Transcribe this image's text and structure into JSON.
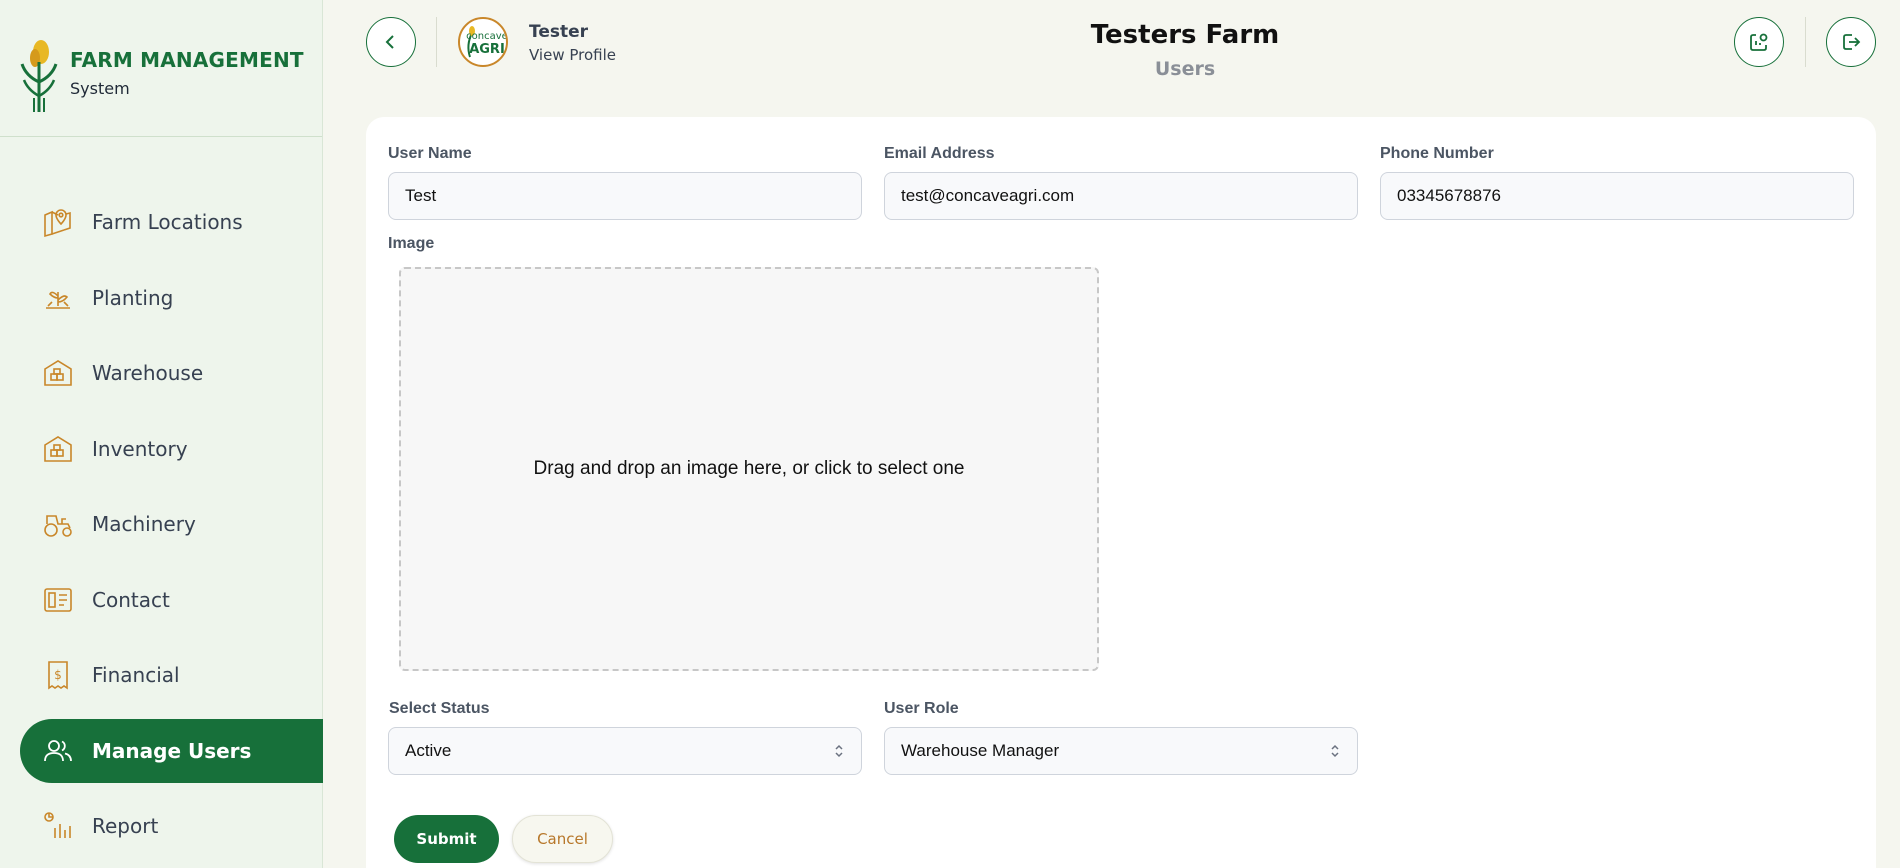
{
  "brand": {
    "title": "FARM MANAGEMENT",
    "subtitle": "System"
  },
  "sidebar": {
    "items": [
      {
        "label": "Farm Locations",
        "icon": "map-pin-icon",
        "active": false
      },
      {
        "label": "Planting",
        "icon": "plant-icon",
        "active": false
      },
      {
        "label": "Warehouse",
        "icon": "warehouse-icon",
        "active": false
      },
      {
        "label": "Inventory",
        "icon": "inventory-icon",
        "active": false
      },
      {
        "label": "Machinery",
        "icon": "tractor-icon",
        "active": false
      },
      {
        "label": "Contact",
        "icon": "contact-icon",
        "active": false
      },
      {
        "label": "Financial",
        "icon": "receipt-dollar-icon",
        "active": false
      },
      {
        "label": "Manage Users",
        "icon": "users-icon",
        "active": true
      },
      {
        "label": "Report",
        "icon": "report-icon",
        "active": false
      }
    ]
  },
  "header": {
    "profile_name": "Tester",
    "profile_link": "View Profile",
    "avatar_text": "concave AGRI",
    "farm_title": "Testers Farm",
    "page_subtitle": "Users"
  },
  "form": {
    "username": {
      "label": "User Name",
      "value": "Test"
    },
    "email": {
      "label": "Email Address",
      "value": "test@concaveagri.com"
    },
    "phone": {
      "label": "Phone Number",
      "value": "03345678876"
    },
    "image": {
      "label": "Image",
      "dropzone_text": "Drag and drop an image here, or click to select one"
    },
    "status": {
      "label": "Select Status",
      "value": "Active"
    },
    "role": {
      "label": "User Role",
      "value": "Warehouse Manager"
    },
    "submit_label": "Submit",
    "cancel_label": "Cancel"
  },
  "colors": {
    "primary": "#17703a",
    "accent": "#c9872a",
    "sidebar_bg": "#eef5ec",
    "page_bg": "#f5f6ef"
  }
}
